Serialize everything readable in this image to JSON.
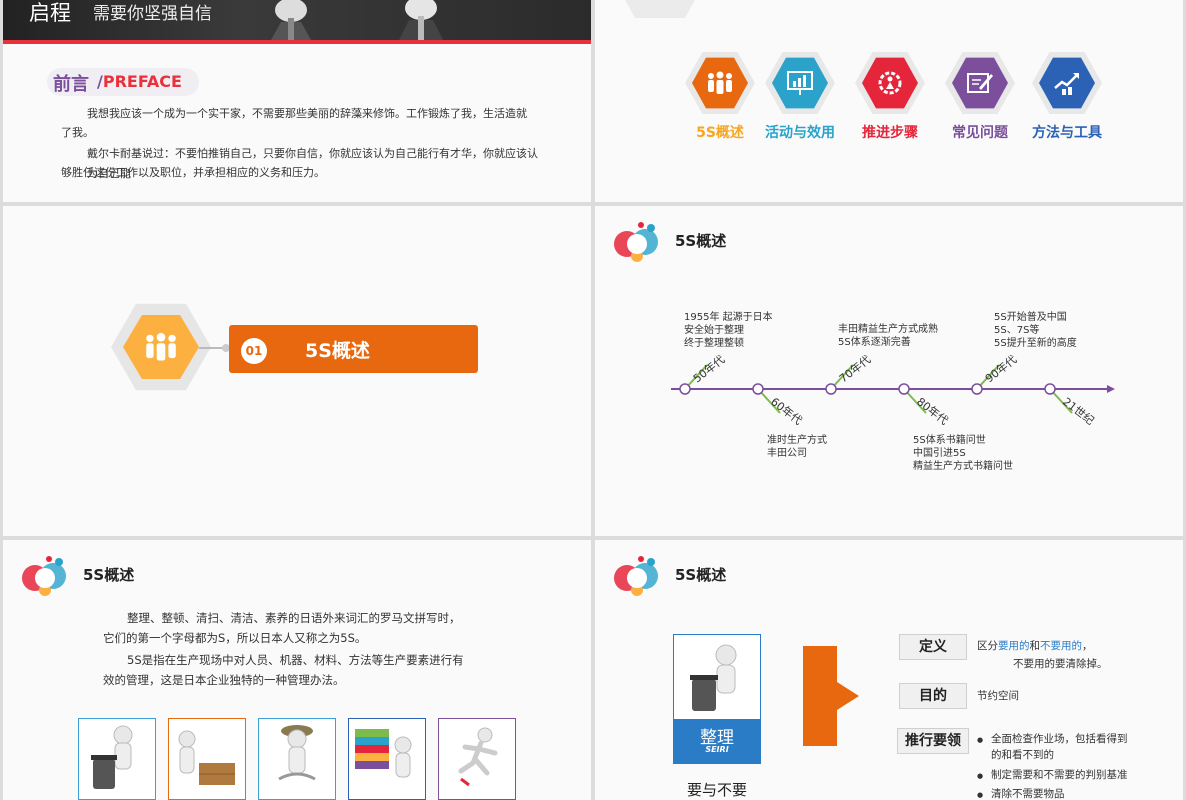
{
  "slide1": {
    "title": "启程",
    "subtitle": "需要你坚强自信",
    "heading_cn": "前言",
    "heading_slash": "/",
    "heading_en": "PREFACE",
    "para1_line1": "我想我应该一个成为一个实干家，不需要那些美丽的辞藻来修饰。工作锻炼了我，生活造就",
    "para1_line2": "了我。",
    "para2_line1": "戴尔卡耐基说过：不要怕推销自己，只要你自信，你就应该认为自己能行有才华，你就应该认为自己能",
    "para2_line2": "够胜任这份工作以及职位，并承担相应的义务和压力。"
  },
  "slide2": {
    "menu": [
      {
        "label": "5S概述",
        "color": "#f6a623",
        "hex": "#e7680f",
        "icon": "people-icon"
      },
      {
        "label": "活动与效用",
        "color": "#2aa2c9",
        "hex": "#2aa2c9",
        "icon": "presentation-icon"
      },
      {
        "label": "推进步骤",
        "color": "#e5263a",
        "hex": "#e5263a",
        "icon": "gear-person-icon"
      },
      {
        "label": "常见问题",
        "color": "#7b4f9c",
        "hex": "#7b4f9c",
        "icon": "edit-icon"
      },
      {
        "label": "方法与工具",
        "color": "#2b62b6",
        "hex": "#2b62b6",
        "icon": "growth-chart-icon"
      }
    ]
  },
  "slide3": {
    "number": "01",
    "title": "5S概述"
  },
  "slide4": {
    "title": "5S概述",
    "eras": [
      "50年代",
      "60年代",
      "70年代",
      "80年代",
      "90年代",
      "21世纪"
    ],
    "top_notes": [
      [
        "1955年  起源于日本",
        "安全始于整理",
        "终于整理整顿"
      ],
      [
        "丰田精益生产方式成熟",
        "5S体系逐渐完善"
      ],
      [
        "5S开始普及中国",
        "5S、7S等",
        "5S提升至新的高度"
      ]
    ],
    "bottom_notes": [
      [
        "准时生产方式",
        "丰田公司"
      ],
      [
        "5S体系书籍问世",
        "中国引进5S",
        "精益生产方式书籍问世"
      ]
    ]
  },
  "slide5": {
    "title": "5S概述",
    "p1_line1": "整理、整顿、清扫、清洁、素养的日语外来词汇的罗马文拼写时，",
    "p1_line2": "它们的第一个字母都为S，所以日本人又称之为5S。",
    "p2_line1": "5S是指在生产现场中对人员、机器、材料、方法等生产要素进行有",
    "p2_line2": "效的管理，这是日本企业独特的一种管理办法。",
    "thumbs": [
      {
        "border": "#3aa0d6",
        "icon": "trash-figure-icon"
      },
      {
        "border": "#e7680f",
        "icon": "cart-figure-icon"
      },
      {
        "border": "#3aa0d6",
        "icon": "cleaning-figure-icon"
      },
      {
        "border": "#2b62b6",
        "icon": "books-figure-icon"
      },
      {
        "border": "#7b4f9c",
        "icon": "running-figure-icon"
      }
    ]
  },
  "slide6": {
    "title": "5S概述",
    "card_title": "整理",
    "card_sub": "SEIRI",
    "caption": "要与不要",
    "def_label": "定义",
    "def_pre": "区分",
    "def_hl1": "要用的",
    "def_mid": "和",
    "def_hl2": "不要用的",
    "def_post": "，",
    "def_line2": "不要用的要清除掉。",
    "goal_label": "目的",
    "goal_text": "节约空间",
    "req_label": "推行要领",
    "req_items": [
      "全面检查作业场，包括看得到",
      "的和看不到的",
      "制定需要和不需要的判别基准",
      "清除不需要物品"
    ]
  }
}
